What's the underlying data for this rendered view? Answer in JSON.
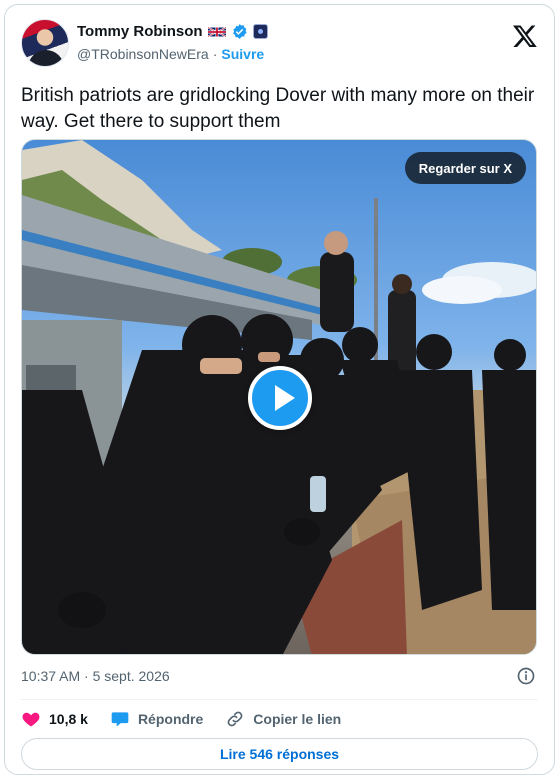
{
  "author": {
    "name": "Tommy Robinson",
    "handle": "@TRobinsonNewEra",
    "separator": "·",
    "follow_label": "Suivre"
  },
  "tweet": {
    "text": "British patriots are gridlocking Dover with many more on their way. Get there to support them",
    "timestamp": "10:37 AM · 5 sept. 2026"
  },
  "media": {
    "watch_label": "Regarder sur X"
  },
  "actions": {
    "likes": "10,8 k",
    "reply_label": "Répondre",
    "copy_label": "Copier le lien"
  },
  "replies_button": "Lire 546 réponses",
  "colors": {
    "accent": "#1d9bf0",
    "like": "#f91880",
    "text": "#0f1419",
    "muted": "#536471"
  }
}
